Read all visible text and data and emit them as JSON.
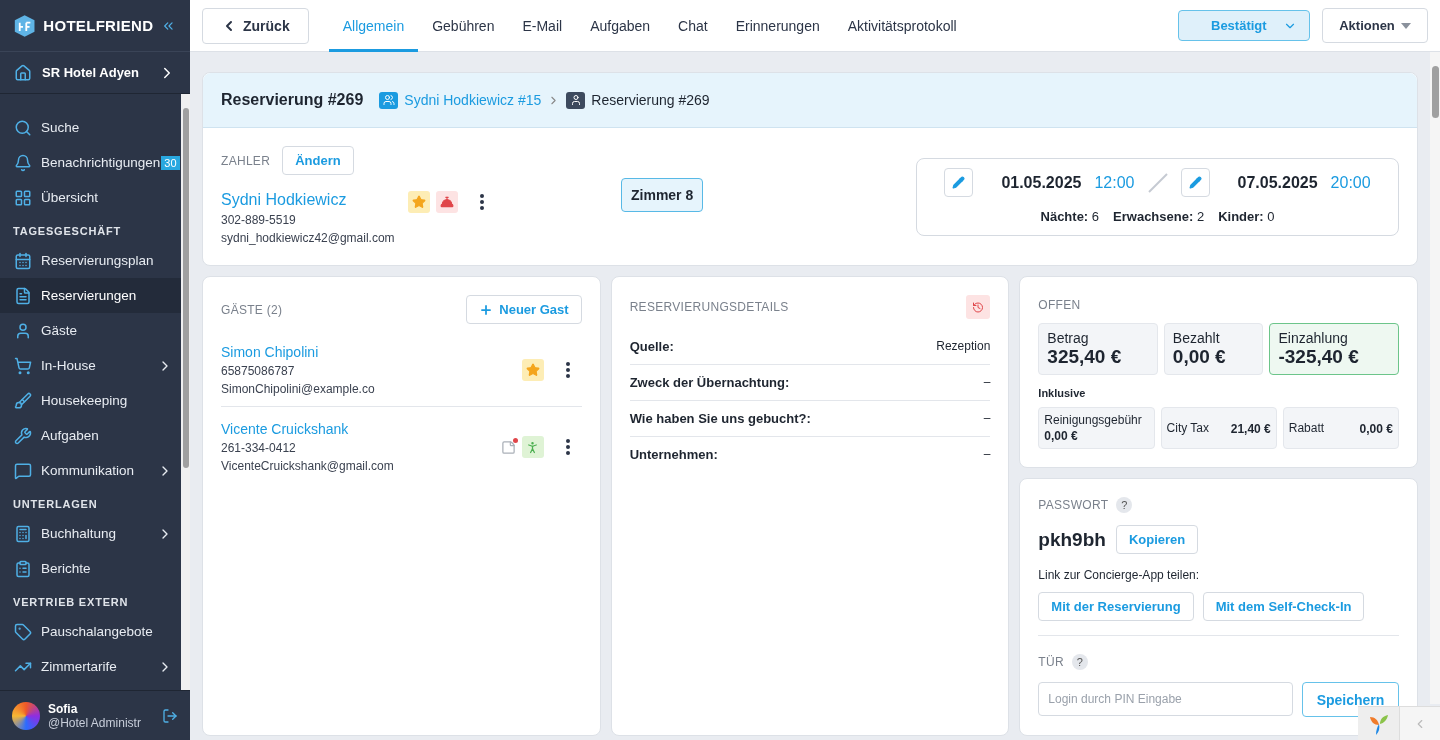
{
  "sidebar": {
    "brand": "HOTELFRIEND",
    "hotel": "SR Hotel Adyen",
    "items": [
      {
        "kind": "item",
        "label": "Suche",
        "selected": false,
        "submenu": false
      },
      {
        "kind": "item",
        "label": "Benachrichtigungen",
        "badge": "30",
        "selected": false,
        "submenu": false
      },
      {
        "kind": "item",
        "label": "Übersicht",
        "selected": false,
        "submenu": false
      },
      {
        "kind": "section",
        "label": "TAGESGESCHÄFT"
      },
      {
        "kind": "item",
        "label": "Reservierungsplan",
        "selected": false,
        "submenu": false
      },
      {
        "kind": "item",
        "label": "Reservierungen",
        "selected": true,
        "submenu": false
      },
      {
        "kind": "item",
        "label": "Gäste",
        "selected": false,
        "submenu": false
      },
      {
        "kind": "item",
        "label": "In-House",
        "selected": false,
        "submenu": true
      },
      {
        "kind": "item",
        "label": "Housekeeping",
        "selected": false,
        "submenu": false
      },
      {
        "kind": "item",
        "label": "Aufgaben",
        "selected": false,
        "submenu": false
      },
      {
        "kind": "item",
        "label": "Kommunikation",
        "selected": false,
        "submenu": true
      },
      {
        "kind": "section",
        "label": "UNTERLAGEN"
      },
      {
        "kind": "item",
        "label": "Buchhaltung",
        "selected": false,
        "submenu": true
      },
      {
        "kind": "item",
        "label": "Berichte",
        "selected": false,
        "submenu": false
      },
      {
        "kind": "section",
        "label": "VERTRIEB EXTERN"
      },
      {
        "kind": "item",
        "label": "Pauschalangebote",
        "selected": false,
        "submenu": false
      },
      {
        "kind": "item",
        "label": "Zimmertarife",
        "selected": false,
        "submenu": true
      }
    ],
    "user": {
      "name": "Sofia",
      "role": "@Hotel Administr"
    }
  },
  "topbar": {
    "back": "Zurück",
    "tabs": [
      {
        "label": "Allgemein",
        "selected": true
      },
      {
        "label": "Gebühren",
        "selected": false
      },
      {
        "label": "E-Mail",
        "selected": false
      },
      {
        "label": "Aufgaben",
        "selected": false
      },
      {
        "label": "Chat",
        "selected": false
      },
      {
        "label": "Erinnerungen",
        "selected": false
      },
      {
        "label": "Aktivitätsprotokoll",
        "selected": false
      }
    ],
    "status": "Bestätigt",
    "actions": "Aktionen"
  },
  "reservation": {
    "title": "Reservierung #269",
    "breadcrumb": [
      "Sydni Hodkiewicz #15",
      "Reservierung #269"
    ],
    "payer": {
      "label": "ZAHLER",
      "change": "Ändern",
      "name": "Sydni Hodkiewicz",
      "phone": "302-889-5519",
      "email": "sydni_hodkiewicz42@gmail.com",
      "vip": true,
      "service": true
    },
    "room": "Zimmer 8",
    "arrival": {
      "date": "01.05.2025",
      "time": "12:00"
    },
    "departure": {
      "date": "07.05.2025",
      "time": "20:00"
    },
    "stats": [
      {
        "label": "Nächte:",
        "value": "6"
      },
      {
        "label": "Erwachsene:",
        "value": "2"
      },
      {
        "label": "Kinder:",
        "value": "0"
      }
    ]
  },
  "guests": {
    "title": "GÄSTE (2)",
    "add": "Neuer Gast",
    "items": [
      {
        "name": "Simon Chipolini",
        "phone": "65875086787",
        "email": "SimonChipolini@example.co",
        "vip": true,
        "note": false,
        "checked_in": false
      },
      {
        "name": "Vicente Cruickshank",
        "phone": "261-334-0412",
        "email": "VicenteCruickshank@gmail.com",
        "vip": false,
        "note": true,
        "checked_in": true
      }
    ]
  },
  "details": {
    "title": "RESERVIERUNGSDETAILS",
    "rows": [
      {
        "label": "Quelle:",
        "value": "Rezeption"
      },
      {
        "label": "Zweck der Übernachtung:",
        "value": "–"
      },
      {
        "label": "Wie haben Sie uns gebucht?:",
        "value": "–"
      },
      {
        "label": "Unternehmen:",
        "value": "–"
      }
    ]
  },
  "balance": {
    "title": "OFFEN",
    "totals": [
      {
        "label": "Betrag",
        "value": "325,40 €",
        "highlight": false
      },
      {
        "label": "Bezahlt",
        "value": "0,00 €",
        "highlight": false
      },
      {
        "label": "Einzahlung",
        "value": "-325,40 €",
        "highlight": true
      }
    ],
    "included_label": "Inklusive",
    "included": [
      {
        "label": "Reinigungsgebühr",
        "value": "0,00 €",
        "stacked": true
      },
      {
        "label": "City Tax",
        "value": "21,40 €",
        "stacked": false
      },
      {
        "label": "Rabatt",
        "value": "0,00 €",
        "stacked": false
      }
    ]
  },
  "password": {
    "title": "PASSWORT",
    "help": "?",
    "value": "pkh9bh",
    "copy": "Kopieren",
    "share_label": "Link zur Concierge-App teilen:",
    "share_buttons": [
      "Mit der Reservierung",
      "Mit dem Self-Check-In"
    ]
  },
  "door": {
    "title": "TÜR",
    "help": "?",
    "placeholder": "Login durch PIN Eingabe",
    "save": "Speichern"
  }
}
